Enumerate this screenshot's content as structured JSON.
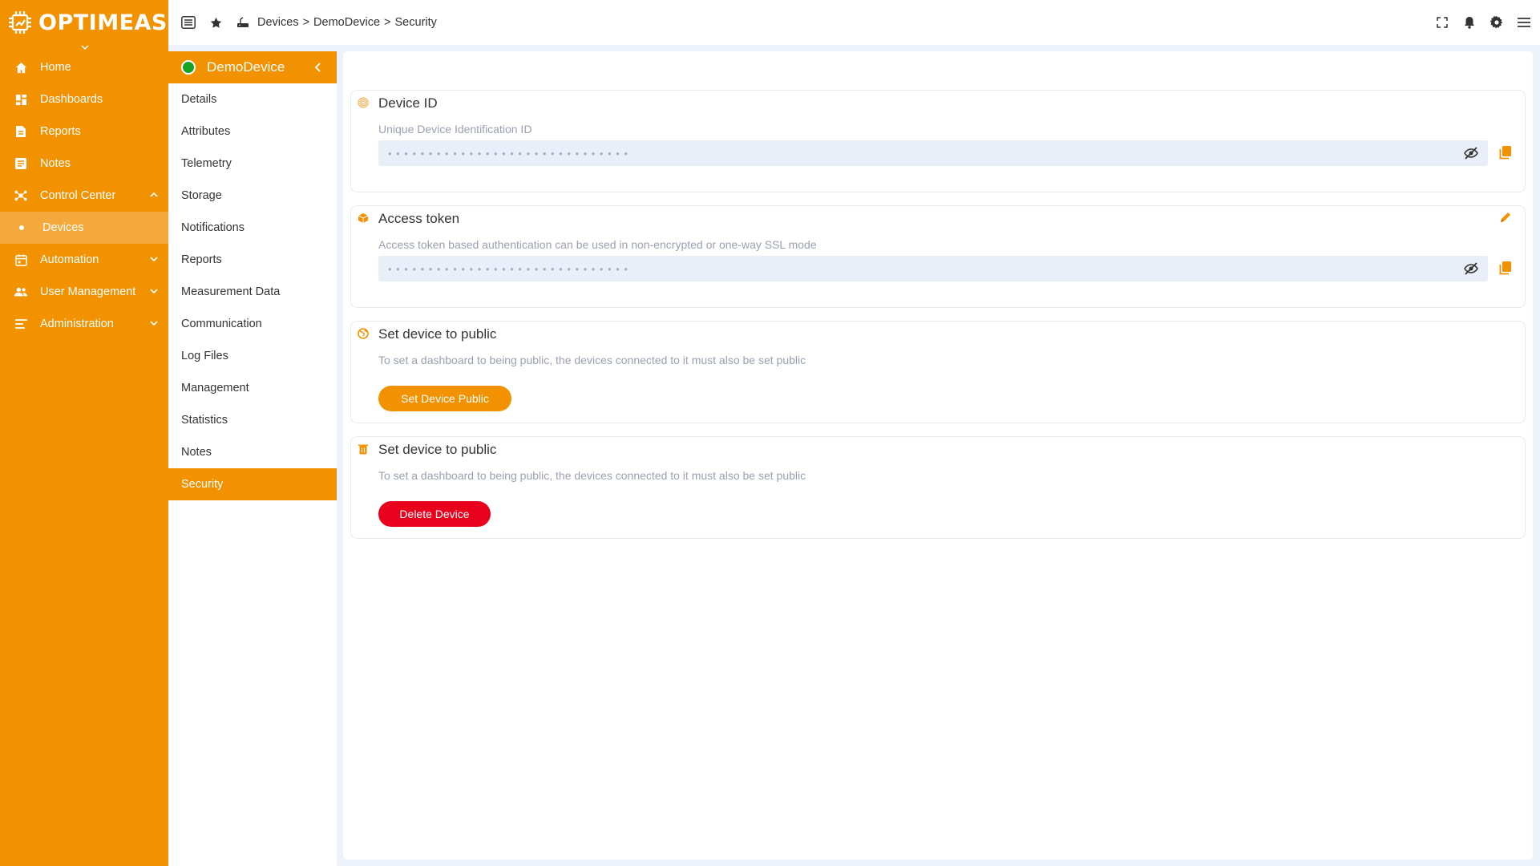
{
  "brand": {
    "name": "OPTIMEAS"
  },
  "colors": {
    "accent": "#f39200",
    "danger": "#e8001c",
    "online": "#17a325"
  },
  "sidebar": {
    "items": [
      {
        "label": "Home",
        "icon": "home-icon"
      },
      {
        "label": "Dashboards",
        "icon": "dashboard-icon"
      },
      {
        "label": "Reports",
        "icon": "report-icon"
      },
      {
        "label": "Notes",
        "icon": "note-icon"
      },
      {
        "label": "Control Center",
        "icon": "network-icon",
        "expanded": true
      },
      {
        "label": "Devices",
        "active": true
      },
      {
        "label": "Automation",
        "icon": "calendar-icon"
      },
      {
        "label": "User Management",
        "icon": "users-icon"
      },
      {
        "label": "Administration",
        "icon": "list-icon"
      }
    ]
  },
  "topbar": {
    "breadcrumb": [
      "Devices",
      ">",
      "DemoDevice",
      ">",
      "Security"
    ],
    "icons": [
      "menu-icon",
      "star-icon",
      "device-icon",
      "fullscreen-icon",
      "bell-icon",
      "gear-icon",
      "hamburger-icon"
    ]
  },
  "device": {
    "name": "DemoDevice",
    "status": "online",
    "menu": [
      "Details",
      "Attributes",
      "Telemetry",
      "Storage",
      "Notifications",
      "Reports",
      "Measurement Data",
      "Communication",
      "Log Files",
      "Management",
      "Statistics",
      "Notes",
      "Security"
    ],
    "active_menu": "Security"
  },
  "security": {
    "device_id": {
      "title": "Device ID",
      "description": "Unique Device Identification ID",
      "masked_value": "••••••••••••••••••••••••••••••"
    },
    "access_token": {
      "title": "Access token",
      "description": "Access token based authentication can be used in non-encrypted or one-way SSL mode",
      "masked_value": "••••••••••••••••••••••••••••••"
    },
    "public": {
      "title": "Set device to public",
      "description": "To set a dashboard to being public, the devices connected to it must also be set public",
      "button": "Set Device Public"
    },
    "delete": {
      "title": "Set device to public",
      "description": "To set a dashboard to being public, the devices connected to it must also be set public",
      "button": "Delete Device"
    }
  }
}
